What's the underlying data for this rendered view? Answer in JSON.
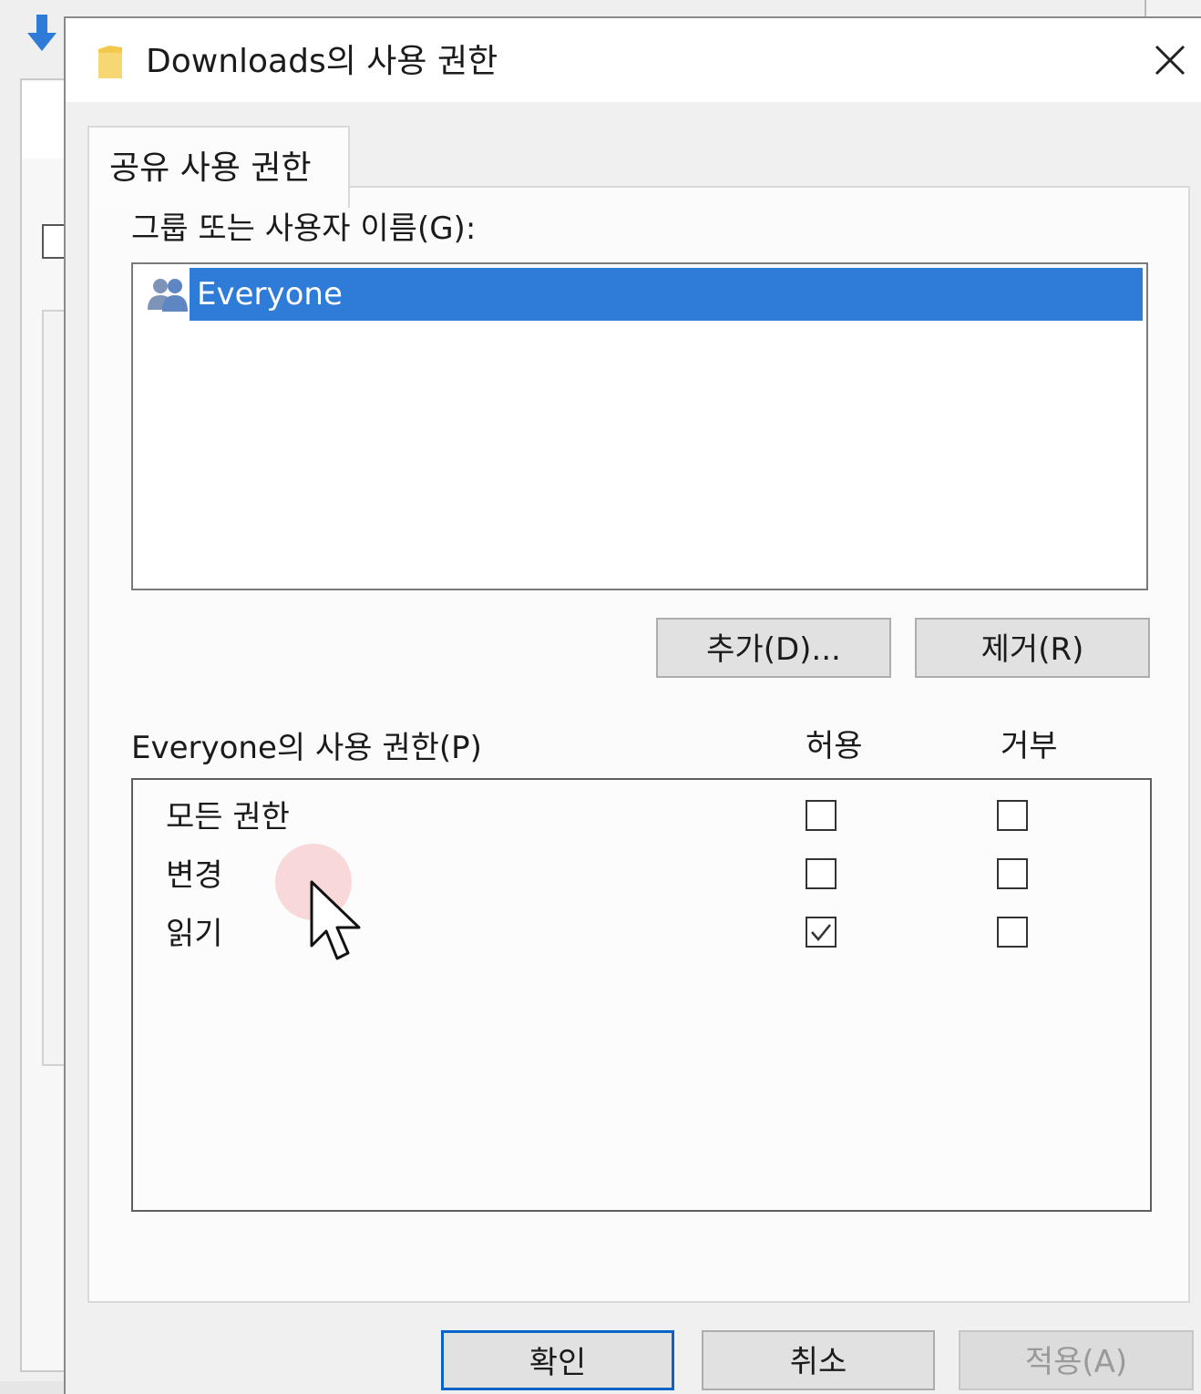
{
  "window": {
    "title": "Downloads의 사용 권한",
    "close_icon": "close-icon",
    "folder_icon": "folder-icon"
  },
  "tabs": [
    {
      "label": "공유 사용 권한",
      "active": true
    }
  ],
  "group_section": {
    "label": "그룹 또는 사용자 이름(G):",
    "items": [
      {
        "name": "Everyone",
        "icon": "users-group-icon",
        "selected": true
      }
    ],
    "add_button": "추가(D)...",
    "remove_button": "제거(R)"
  },
  "permissions": {
    "label": "Everyone의 사용 권한(P)",
    "allow_header": "허용",
    "deny_header": "거부",
    "rows": [
      {
        "name": "모든 권한",
        "allow": false,
        "deny": false
      },
      {
        "name": "변경",
        "allow": false,
        "deny": false
      },
      {
        "name": "읽기",
        "allow": true,
        "deny": false
      }
    ]
  },
  "footer": {
    "ok": "확인",
    "cancel": "취소",
    "apply": "적용(A)",
    "apply_enabled": false
  },
  "colors": {
    "selection": "#2f7bd8",
    "default_button_border": "#0a64c8",
    "download_arrow": "#2f7bd8",
    "folder": "#f2c94c"
  }
}
